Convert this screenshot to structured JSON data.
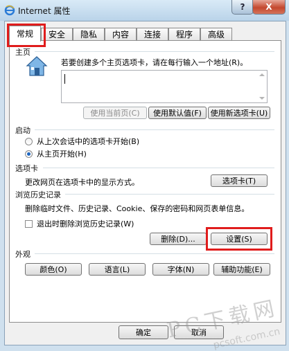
{
  "window": {
    "title": "Internet 属性",
    "help_label": "?",
    "close_label": "X"
  },
  "tabs": [
    {
      "label": "常规",
      "active": true
    },
    {
      "label": "安全"
    },
    {
      "label": "隐私"
    },
    {
      "label": "内容"
    },
    {
      "label": "连接"
    },
    {
      "label": "程序"
    },
    {
      "label": "高级"
    }
  ],
  "home": {
    "section_label": "主页",
    "hint": "若要创建多个主页选项卡，请在每行输入一个地址(R)。",
    "url_value": "",
    "btn_use_current": "使用当前页(C)",
    "btn_use_default": "使用默认值(F)",
    "btn_use_new_tab": "使用新选项卡(U)"
  },
  "startup": {
    "section_label": "启动",
    "option1": "从上次会话中的选项卡开始(B)",
    "option2": "从主页开始(H)",
    "selected": 2
  },
  "tabs_section": {
    "section_label": "选项卡",
    "desc": "更改网页在选项卡中的显示方式。",
    "btn": "选项卡(T)"
  },
  "history": {
    "section_label": "浏览历史记录",
    "desc": "删除临时文件、历史记录、Cookie、保存的密码和网页表单信息。",
    "checkbox_label": "退出时删除浏览历史记录(W)",
    "checked": false,
    "btn_delete": "删除(D)...",
    "btn_settings": "设置(S)"
  },
  "appearance": {
    "section_label": "外观",
    "btn_colors": "颜色(O)",
    "btn_languages": "语言(L)",
    "btn_fonts": "字体(N)",
    "btn_accessibility": "辅助功能(E)"
  },
  "footer": {
    "ok": "确定",
    "cancel": "取消"
  },
  "watermark": {
    "main": "PC下载网",
    "sub": "pcsoft.com.cn"
  },
  "colors": {
    "highlight": "#e01c1c"
  }
}
